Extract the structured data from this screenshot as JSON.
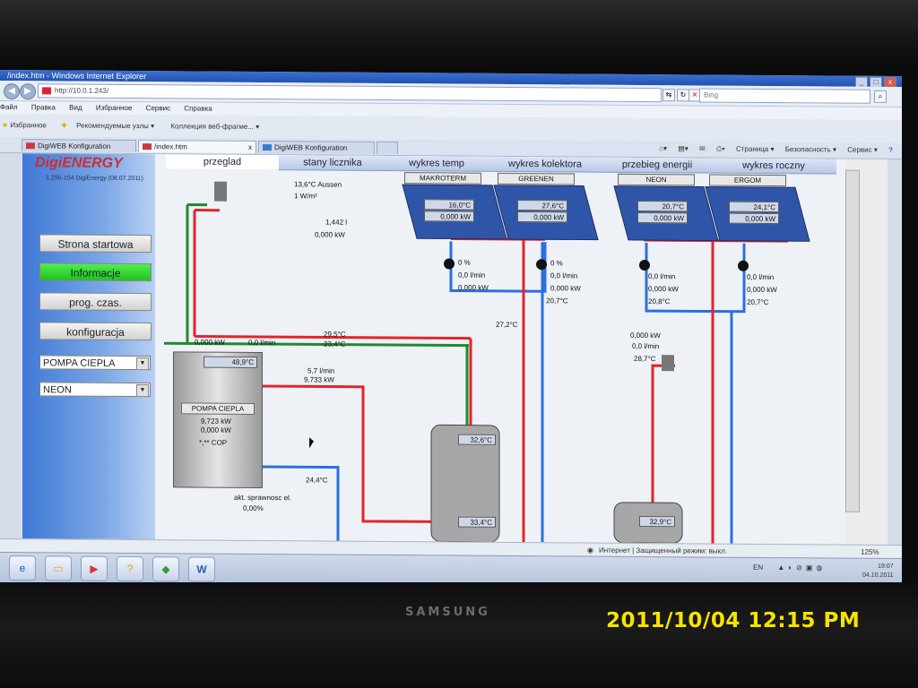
{
  "window": {
    "title": "/index.htm - Windows Internet Explorer",
    "min": "_",
    "max": "□",
    "close": "x"
  },
  "address": {
    "url": "http://10.0.1.243/",
    "search_placeholder": "Bing"
  },
  "menu": [
    "Файл",
    "Правка",
    "Вид",
    "Избранное",
    "Сервис",
    "Справка"
  ],
  "favorites": {
    "label": "Избранное",
    "items": [
      "Рекомендуемые узлы ▾",
      "Коллекция веб-фрагме... ▾"
    ]
  },
  "tabs": [
    {
      "label": "DigiWEB Konfiguration"
    },
    {
      "label": "/index.htm",
      "close": "x"
    },
    {
      "label": "DigiWEB Konfiguration"
    }
  ],
  "commands": [
    "Страница ▾",
    "Безопасность ▾",
    "Сервис ▾",
    "?"
  ],
  "app": {
    "logo": "DigiENERGY",
    "version": "1.296-154 DigiEnergy (08.07.2011)",
    "buttons": [
      "Strona startowa",
      "Informacje",
      "prog. czas.",
      "konfiguracja"
    ],
    "select1": "POMPA CIEPLA",
    "select2": "NEON",
    "nav": [
      "przeglad",
      "stany licznika",
      "wykres temp",
      "wykres kolektora",
      "przebieg energii",
      "wykres roczny"
    ]
  },
  "schematic": {
    "outside": "13,6°C Aussen",
    "irradiance": "1 W/m²",
    "liters": "1,442 l",
    "power0": "0,000 kW",
    "flow_left_kw": "0,000 kW",
    "flow_left_lmin": "0,0 l/min",
    "t1": "29,5°C",
    "t2": "23,4°C",
    "hp_temp": "48,9°C",
    "hp_label": "POMPA CIEPLA",
    "hp_kw1": "9,723 kW",
    "hp_kw2": "0,000 kW",
    "hp_cop": "*,** COP",
    "hp_flow": "5,7 l/min",
    "hp_power": "9,733 kW",
    "return_temp": "24,4°C",
    "efficiency_label": "akt. sprawnosc el.",
    "efficiency_value": "0,00%",
    "tank_top": "32,6°C",
    "tank_bottom": "33,4°C",
    "pipe_temp": "27,2°C",
    "tank2_temp": "32,9°C",
    "right_kw": "0,000 kW",
    "right_lmin": "0,0 l/min",
    "right_temp": "28,7°C",
    "collectors": [
      {
        "name": "MAKROTERM",
        "temp": "16,0°C",
        "power": "0,000 kW",
        "pump": "0 %",
        "flow": "0,0 l/min",
        "kw": "0,000 kW",
        "ret": ""
      },
      {
        "name": "GREENEN",
        "temp": "27,6°C",
        "power": "0,000 kW",
        "pump": "0 %",
        "flow": "0,0 l/min",
        "kw": "0,000 kW",
        "ret": "20,7°C"
      },
      {
        "name": "NEON",
        "temp": "20,7°C",
        "power": "0,000 kW",
        "pump": "",
        "flow": "0,0 l/min",
        "kw": "0,000 kW",
        "ret": "20,8°C"
      },
      {
        "name": "ERGOM",
        "temp": "24,1°C",
        "power": "0,000 kW",
        "pump": "",
        "flow": "0,0 l/min",
        "kw": "0,000 kW",
        "ret": "20,7°C"
      }
    ]
  },
  "status": {
    "zone": "Интернет | Защищенный режим: выкл.",
    "zoom": "125%"
  },
  "taskbar": {
    "lang": "EN",
    "time": "19:07",
    "date": "04.10.2011"
  },
  "monitor": {
    "brand": "SAMSUNG",
    "timestamp": "2011/10/04 12:15 PM"
  },
  "colors": {
    "hot": "#e3242b",
    "cold": "#2b6fe0",
    "green": "#1f8a2e",
    "panel": "#2f55a8"
  }
}
